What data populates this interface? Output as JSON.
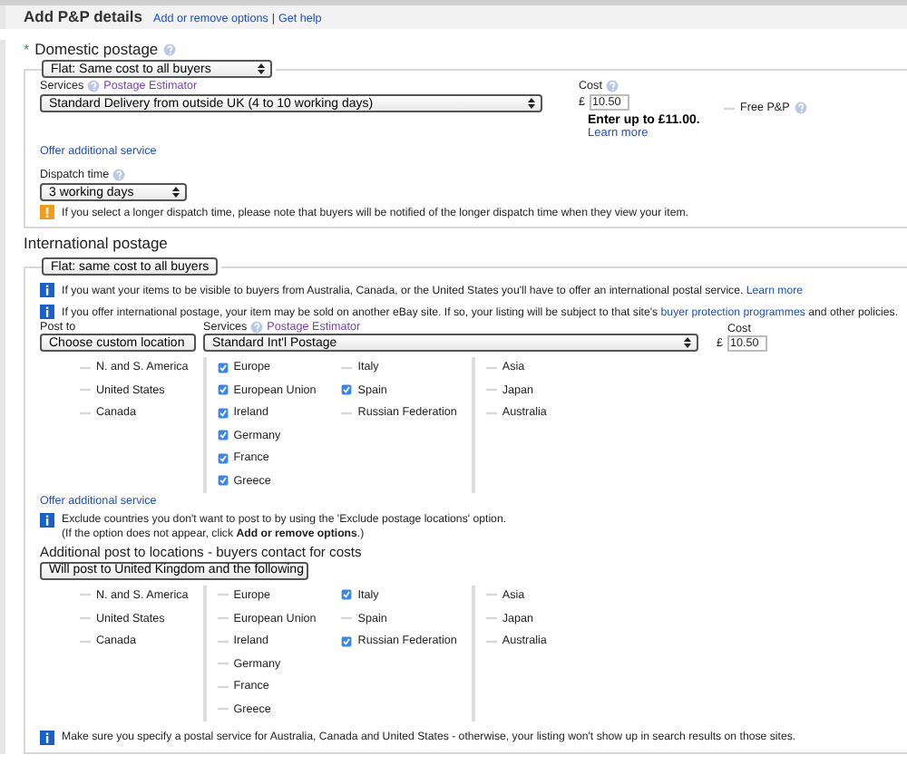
{
  "header": {
    "title": "Add P&P details",
    "links": [
      "Add or remove options",
      "Get help"
    ],
    "separator": "|"
  },
  "domestic": {
    "title": "Domestic postage",
    "required_mark": "*",
    "type_select": "Flat: Same cost to all buyers",
    "services_label": "Services",
    "estimator_link": "Postage Estimator",
    "service_select": "Standard Delivery from outside UK (4 to 10 working days)",
    "cost_label": "Cost",
    "currency": "£",
    "cost": "10.50",
    "cost_limit": "Enter up to £11.00.",
    "learn_more": "Learn more",
    "free_pp": {
      "label": "Free P&P",
      "checked": false
    },
    "offer_additional": "Offer additional service",
    "dispatch_label": "Dispatch time",
    "dispatch_select": "3 working days",
    "dispatch_warning": "If you select a longer dispatch time, please note that buyers will be notified of the longer dispatch time when they view your item."
  },
  "international": {
    "title": "International postage",
    "type_select": "Flat: same cost to all buyers",
    "notices": [
      {
        "text": "If you want your items to be visible to buyers from Australia, Canada, or the United States you'll have to offer an international postal service.",
        "link": "Learn more"
      },
      {
        "text": "If you offer international postage, your item may be sold on another eBay site. If so, your listing will be subject to that site's",
        "link": "buyer protection programmes",
        "after": "and other policies."
      }
    ],
    "post_to_label": "Post to",
    "post_to_select": "Choose custom location",
    "services_label": "Services",
    "estimator_link": "Postage Estimator",
    "service_select": "Standard Int'l Postage",
    "cost_label": "Cost",
    "currency": "£",
    "cost": "10.50",
    "locations": [
      [
        {
          "label": "N. and S. America",
          "checked": false
        },
        {
          "label": "United States",
          "checked": false
        },
        {
          "label": "Canada",
          "checked": false
        }
      ],
      [
        {
          "label": "Europe",
          "checked": true
        },
        {
          "label": "European Union",
          "checked": true
        },
        {
          "label": "Ireland",
          "checked": true
        },
        {
          "label": "Germany",
          "checked": true
        },
        {
          "label": "France",
          "checked": true
        },
        {
          "label": "Greece",
          "checked": true
        }
      ],
      [
        {
          "label": "Italy",
          "checked": false
        },
        {
          "label": "Spain",
          "checked": true
        },
        {
          "label": "Russian Federation",
          "checked": false
        }
      ],
      [
        {
          "label": "Asia",
          "checked": false
        },
        {
          "label": "Japan",
          "checked": false
        },
        {
          "label": "Australia",
          "checked": false
        }
      ]
    ],
    "offer_additional": "Offer additional service",
    "exclude_notice": [
      "Exclude countries you don't want to post to by using the 'Exclude postage locations' option.",
      "(If the option does not appear, click **Add or remove options**.)"
    ],
    "additional_title": "Additional post to locations - buyers contact for costs",
    "additional_select": "Will post to United Kingdom and the following",
    "additional_locations": [
      [
        {
          "label": "N. and S. America",
          "checked": false
        },
        {
          "label": "United States",
          "checked": false
        },
        {
          "label": "Canada",
          "checked": false
        }
      ],
      [
        {
          "label": "Europe",
          "checked": false
        },
        {
          "label": "European Union",
          "checked": false
        },
        {
          "label": "Ireland",
          "checked": false
        },
        {
          "label": "Germany",
          "checked": false
        },
        {
          "label": "France",
          "checked": false
        },
        {
          "label": "Greece",
          "checked": false
        }
      ],
      [
        {
          "label": "Italy",
          "checked": true
        },
        {
          "label": "Spain",
          "checked": false
        },
        {
          "label": "Russian Federation",
          "checked": true
        }
      ],
      [
        {
          "label": "Asia",
          "checked": false
        },
        {
          "label": "Japan",
          "checked": false
        },
        {
          "label": "Australia",
          "checked": false
        }
      ]
    ],
    "footer_notice": "Make sure you specify a postal service for Australia, Canada and United States - otherwise, your listing won't show up in search results on those sites."
  }
}
